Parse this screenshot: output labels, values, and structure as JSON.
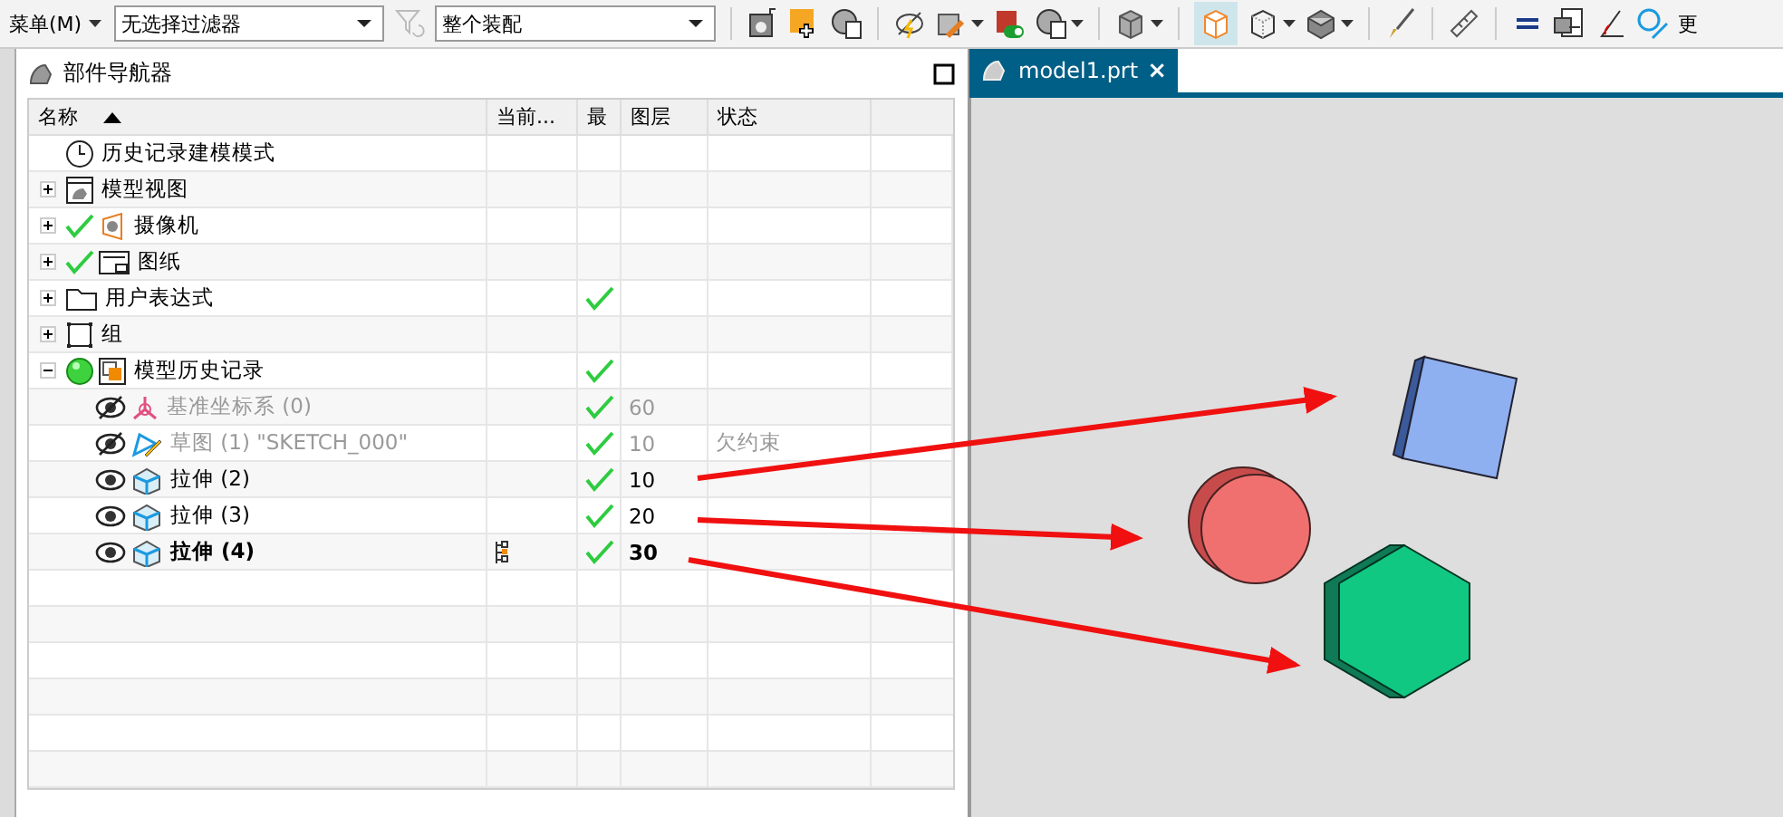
{
  "toolbar": {
    "menu": "菜单(M)",
    "filter": "无选择过滤器",
    "scope": "整个装配",
    "update": "更"
  },
  "navigator": {
    "title": "部件导航器",
    "columns": [
      "名称",
      "当前...",
      "最",
      "图层",
      "状态"
    ],
    "rows": [
      {
        "label": "历史记录建模模式",
        "kind": "clock",
        "checked": false,
        "latest": false
      },
      {
        "label": "模型视图",
        "kind": "view",
        "expanded": false,
        "checked": false,
        "latest": false
      },
      {
        "label": "摄像机",
        "kind": "camera",
        "expanded": false,
        "checked": true,
        "latest": false
      },
      {
        "label": "图纸",
        "kind": "sheet",
        "expanded": false,
        "checked": true,
        "latest": false
      },
      {
        "label": "用户表达式",
        "kind": "folder",
        "expanded": false,
        "checked": false,
        "latest": true
      },
      {
        "label": "组",
        "kind": "group",
        "expanded": false,
        "checked": false,
        "latest": false
      },
      {
        "label": "模型历史记录",
        "kind": "history",
        "expanded": true,
        "checked": false,
        "latest": true,
        "children": [
          {
            "label": "基准坐标系 (0)",
            "kind": "datum",
            "visible": false,
            "greyed": true,
            "current": false,
            "latest": true,
            "layer": "60"
          },
          {
            "label": "草图 (1) \"SKETCH_000\"",
            "kind": "sketch",
            "visible": false,
            "greyed": true,
            "current": false,
            "latest": true,
            "layer": "10",
            "status": "欠约束"
          },
          {
            "label": "拉伸 (2)",
            "kind": "extrude",
            "visible": true,
            "greyed": false,
            "current": false,
            "latest": true,
            "layer": "10"
          },
          {
            "label": "拉伸 (3)",
            "kind": "extrude",
            "visible": true,
            "greyed": false,
            "current": false,
            "latest": true,
            "layer": "20"
          },
          {
            "label": "拉伸 (4)",
            "kind": "extrude",
            "visible": true,
            "greyed": false,
            "current": true,
            "latest": true,
            "layer": "30"
          }
        ]
      }
    ]
  },
  "graphics": {
    "tab": {
      "label": "model1.prt",
      "close": "×",
      "selected": true
    }
  }
}
